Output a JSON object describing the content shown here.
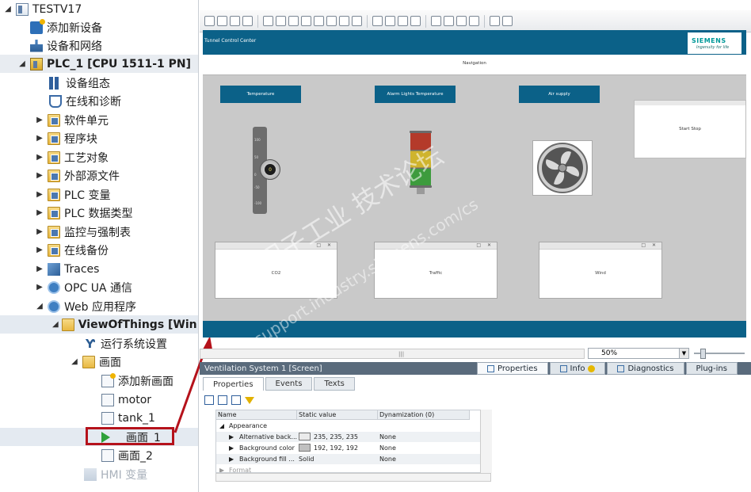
{
  "tree": {
    "items": [
      {
        "label": "TESTV17"
      },
      {
        "label": "添加新设备"
      },
      {
        "label": "设备和网络"
      },
      {
        "label": "PLC_1 [CPU 1511-1 PN]"
      },
      {
        "label": "设备组态"
      },
      {
        "label": "在线和诊断"
      },
      {
        "label": "软件单元"
      },
      {
        "label": "程序块"
      },
      {
        "label": "工艺对象"
      },
      {
        "label": "外部源文件"
      },
      {
        "label": "PLC 变量"
      },
      {
        "label": "PLC 数据类型"
      },
      {
        "label": "监控与强制表"
      },
      {
        "label": "在线备份"
      },
      {
        "label": "Traces"
      },
      {
        "label": "OPC UA 通信"
      },
      {
        "label": "Web 应用程序"
      },
      {
        "label": "ViewOfThings [Win..."
      },
      {
        "label": "运行系统设置"
      },
      {
        "label": "画面"
      },
      {
        "label": "添加新画面"
      },
      {
        "label": "motor"
      },
      {
        "label": "tank_1"
      },
      {
        "label": "画面_1"
      },
      {
        "label": "画面_2"
      },
      {
        "label": "HMI 变量"
      }
    ]
  },
  "screen": {
    "header_title": "Tunnel Control Center",
    "logo_text": "SIEMENS",
    "logo_tagline": "Ingenuity for life",
    "navigation": "Navigation",
    "buttons": {
      "temperature": "Temperature",
      "alarm": "Alarm Lights Temperature",
      "air": "Air supply"
    },
    "start_stop": "Start Stop",
    "gauge": {
      "ticks": [
        "100",
        "50",
        "0",
        "-50",
        "-100"
      ],
      "value": "0"
    },
    "windows": {
      "co2": "CO2",
      "traffic": "Traffic",
      "wind": "Wind"
    },
    "window_controls": "□ ✕"
  },
  "watermark": {
    "line1": "西门子工业  技术论坛",
    "line2": "support.industry.siemens.com/cs"
  },
  "zoom": {
    "value": "50%"
  },
  "inspector": {
    "title": "Ventilation System 1 [Screen]",
    "tabs": {
      "properties": "Properties",
      "info": "Info",
      "diagnostics": "Diagnostics",
      "plugins": "Plug-ins"
    },
    "subtabs": {
      "properties": "Properties",
      "events": "Events",
      "texts": "Texts"
    },
    "columns": {
      "name": "Name",
      "static_value": "Static value",
      "dynamization": "Dynamization (0)"
    },
    "rows": [
      {
        "name": "Appearance",
        "value": "",
        "dyn": ""
      },
      {
        "name": "Alternative back...",
        "value": "235, 235, 235",
        "dyn": "None"
      },
      {
        "name": "Background color",
        "value": "192, 192, 192",
        "dyn": "None"
      },
      {
        "name": "Background fill ...",
        "value": "Solid",
        "dyn": "None"
      },
      {
        "name": "Format",
        "value": "",
        "dyn": ""
      }
    ]
  },
  "colors": {
    "hmi_blue": "#0b6188",
    "highlight_red": "#b5121b"
  }
}
